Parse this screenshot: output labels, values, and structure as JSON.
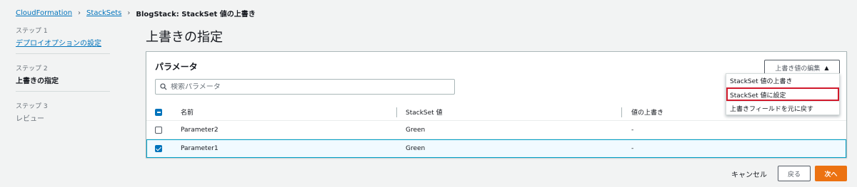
{
  "breadcrumb": {
    "items": [
      "CloudFormation",
      "StackSets"
    ],
    "current": "BlogStack: StackSet 値の上書き",
    "separator": "›"
  },
  "steps": [
    {
      "num": "ステップ 1",
      "label": "デプロイオプションの設定"
    },
    {
      "num": "ステップ 2",
      "label": "上書きの指定"
    },
    {
      "num": "ステップ 3",
      "label": "レビュー"
    }
  ],
  "page": {
    "title": "上書きの指定"
  },
  "panel": {
    "title": "パラメータ",
    "search_placeholder": "検索パラメータ",
    "edit_button": "上書き値の編集",
    "edit_caret": "▲"
  },
  "table": {
    "columns": [
      "名前",
      "StackSet 値",
      "値の上書き"
    ],
    "rows": [
      {
        "name": "Parameter2",
        "value": "Green",
        "override": "-",
        "checked": false
      },
      {
        "name": "Parameter1",
        "value": "Green",
        "override": "-",
        "checked": true
      }
    ]
  },
  "menu": {
    "items": [
      "StackSet 値の上書き",
      "StackSet 値に設定",
      "上書きフィールドを元に戻す"
    ]
  },
  "footer": {
    "cancel": "キャンセル",
    "back": "戻る",
    "next": "次へ"
  },
  "colors": {
    "link": "#0073bb",
    "primary": "#ec7211",
    "highlight": "#d1192b"
  }
}
